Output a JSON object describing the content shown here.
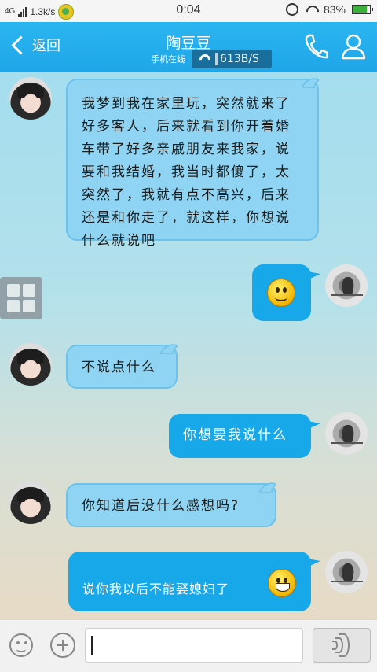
{
  "status_bar": {
    "network": "4G",
    "speed": "1.3k/s",
    "time": "0:04",
    "battery": "83%",
    "battery_level": 0.83
  },
  "header": {
    "back_label": "返回",
    "title": "陶豆豆",
    "subtitle": "手机在线",
    "net_speed": "613B/S"
  },
  "messages": [
    {
      "from": "peer",
      "text": "我梦到我在家里玩，突然就来了好多客人，后来就看到你开着婚车带了好多亲戚朋友来我家，说要和我结婚，我当时都傻了，太突然了，我就有点不高兴，后来还是和你走了，就这样，你想说什么就说吧"
    },
    {
      "from": "me",
      "text": "",
      "emoji": "smile-emoji"
    },
    {
      "from": "peer",
      "text": "不说点什么"
    },
    {
      "from": "me",
      "text": "你想要我说什么"
    },
    {
      "from": "peer",
      "text": "你知道后没什么感想吗?"
    },
    {
      "from": "me",
      "text": "说你我以后不能娶媳妇了",
      "emoji": "grin-emoji"
    }
  ],
  "input": {
    "value": "",
    "placeholder": ""
  },
  "colors": {
    "header_bg": "#1ea6e8",
    "peer_bubble": "#8fd4f2",
    "my_bubble": "#17a8ea"
  }
}
